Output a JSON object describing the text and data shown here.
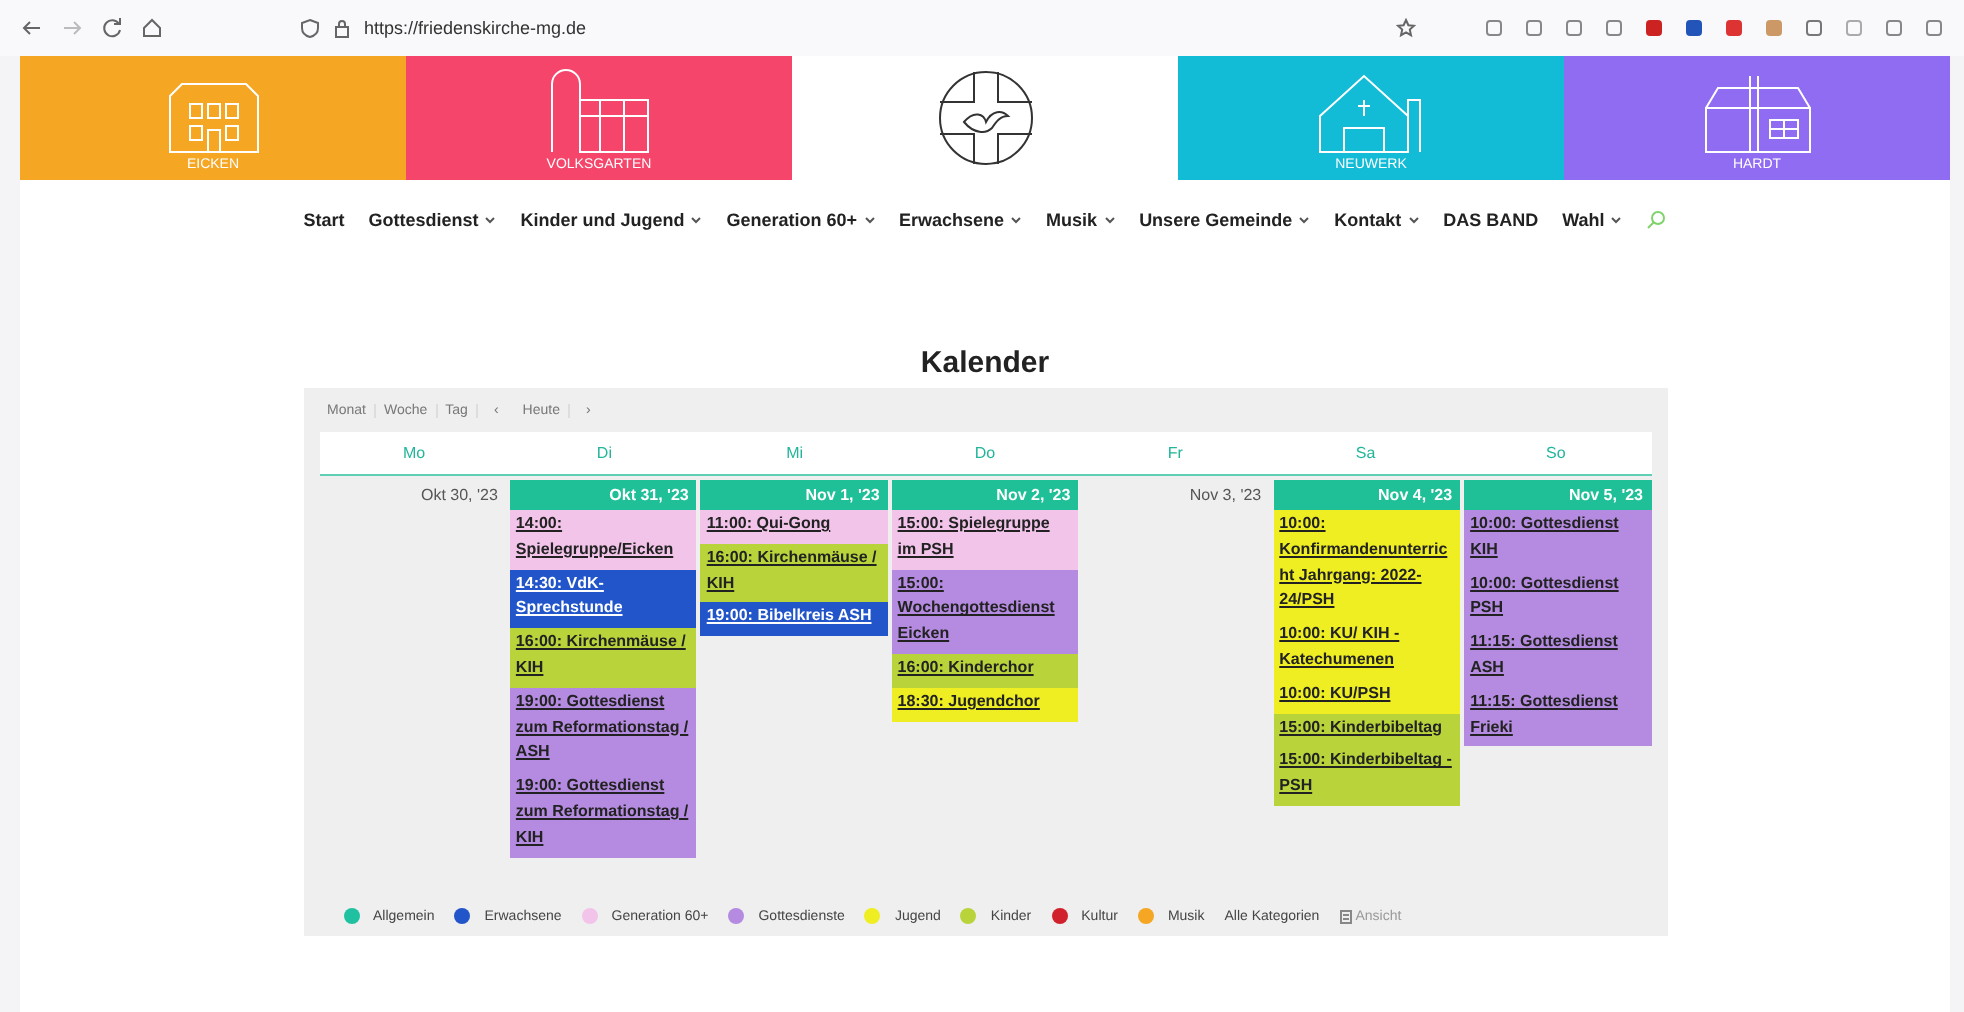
{
  "browser": {
    "url": "https://friedenskirche-mg.de"
  },
  "banner": [
    {
      "label": "EICKEN",
      "kind": "villa",
      "color": "#f5a623"
    },
    {
      "label": "VOLKSGARTEN",
      "kind": "hall",
      "color": "#f5456a"
    },
    {
      "kind": "logo"
    },
    {
      "label": "NEUWERK",
      "kind": "church",
      "color": "#12bcd6"
    },
    {
      "label": "HARDT",
      "kind": "house",
      "color": "#8f6cf2"
    }
  ],
  "nav": [
    {
      "label": "Start",
      "has_menu": false
    },
    {
      "label": "Gottesdienst",
      "has_menu": true
    },
    {
      "label": "Kinder und Jugend",
      "has_menu": true
    },
    {
      "label": "Generation 60+",
      "has_menu": true
    },
    {
      "label": "Erwachsene",
      "has_menu": true
    },
    {
      "label": "Musik",
      "has_menu": true
    },
    {
      "label": "Unsere Gemeinde",
      "has_menu": true
    },
    {
      "label": "Kontakt",
      "has_menu": true
    },
    {
      "label": "DAS BAND",
      "has_menu": false
    },
    {
      "label": "Wahl",
      "has_menu": true
    }
  ],
  "title": "Kalender",
  "toolbar": {
    "views": [
      "Monat",
      "Woche",
      "Tag"
    ],
    "prev": "‹",
    "today": "Heute",
    "next": "›"
  },
  "days": [
    {
      "weekday": "Mo",
      "date": "Okt 30, '23"
    },
    {
      "weekday": "Di",
      "date": "Okt 31, '23",
      "events": [
        {
          "text": "14:00: Spielegruppe/Eicken",
          "color": "#f2c4ea"
        },
        {
          "text": "14:30: VdK-Sprechstunde",
          "color": "#2155c9"
        },
        {
          "text": "16:00: Kirchenmäuse / KIH",
          "color": "#b8d43a"
        },
        {
          "text": "19:00: Gottesdienst zum Reformationstag / ASH",
          "color": "#b48be0"
        },
        {
          "text": "19:00: Gottesdienst zum Reformationstag / KIH",
          "color": "#b48be0"
        }
      ]
    },
    {
      "weekday": "Mi",
      "date": "Nov 1, '23",
      "events": [
        {
          "text": "11:00: Qui-Gong",
          "color": "#f2c4ea"
        },
        {
          "text": "16:00: Kirchenmäuse / KIH",
          "color": "#b8d43a"
        },
        {
          "text": "19:00: Bibelkreis ASH",
          "color": "#2155c9"
        }
      ]
    },
    {
      "weekday": "Do",
      "date": "Nov 2, '23",
      "events": [
        {
          "text": "15:00: Spielegruppe im PSH",
          "color": "#f2c4ea"
        },
        {
          "text": "15:00: Wochengottesdienst Eicken",
          "color": "#b48be0"
        },
        {
          "text": "16:00: Kinderchor",
          "color": "#b8d43a"
        },
        {
          "text": "18:30: Jugendchor",
          "color": "#eeee22"
        }
      ]
    },
    {
      "weekday": "Fr",
      "date": "Nov 3, '23"
    },
    {
      "weekday": "Sa",
      "date": "Nov 4, '23",
      "events": [
        {
          "text": "10:00: Konfirmandenunterricht Jahrgang: 2022-24/PSH",
          "color": "#eeee22"
        },
        {
          "text": "10:00: KU/ KIH - Katechumenen",
          "color": "#eeee22"
        },
        {
          "text": "10:00: KU/PSH",
          "color": "#eeee22"
        },
        {
          "text": "15:00: Kinderbibeltag",
          "color": "#b8d43a"
        },
        {
          "text": "15:00: Kinderbibeltag - PSH",
          "color": "#b8d43a"
        }
      ]
    },
    {
      "weekday": "So",
      "date": "Nov 5, '23",
      "events": [
        {
          "text": "10:00: Gottesdienst KIH",
          "color": "#b48be0"
        },
        {
          "text": "10:00: Gottesdienst PSH",
          "color": "#b48be0"
        },
        {
          "text": "11:15: Gottesdienst ASH",
          "color": "#b48be0"
        },
        {
          "text": "11:15: Gottesdienst Frieki",
          "color": "#b48be0"
        }
      ]
    }
  ],
  "legend": [
    {
      "label": "Allgemein",
      "color": "#1fc1a0"
    },
    {
      "label": "Erwachsene",
      "color": "#2155c9"
    },
    {
      "label": "Generation 60+",
      "color": "#f2c4ea"
    },
    {
      "label": "Gottesdienste",
      "color": "#b48be0"
    },
    {
      "label": "Jugend",
      "color": "#eeee22"
    },
    {
      "label": "Kinder",
      "color": "#b8d43a"
    },
    {
      "label": "Kultur",
      "color": "#d0212c"
    },
    {
      "label": "Musik",
      "color": "#f5a623"
    }
  ],
  "all_categories": "Alle Kategorien",
  "view_link": "Ansicht"
}
